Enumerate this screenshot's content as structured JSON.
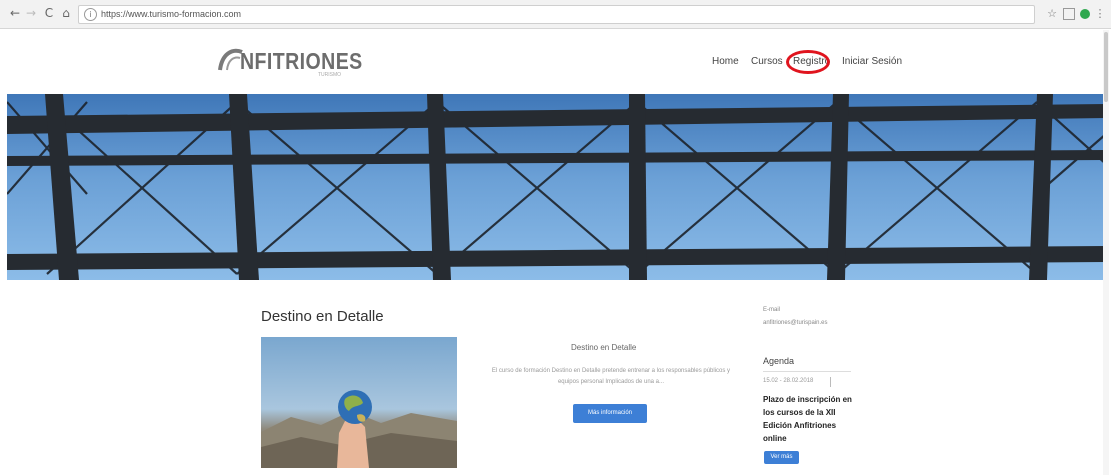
{
  "browser": {
    "url": "https://www.turismo-formacion.com",
    "back_glyph": "←",
    "forward_glyph": "→",
    "reload_glyph": "C",
    "home_glyph": "⌂",
    "info_glyph": "i",
    "star_glyph": "☆",
    "menu_glyph": "⋮"
  },
  "site": {
    "logo_text": "NFITRIONES",
    "logo_sub": "TURISMO",
    "nav": [
      {
        "label": "Home"
      },
      {
        "label": "Cursos"
      },
      {
        "label": "Registro"
      },
      {
        "label": "Iniciar Sesión"
      }
    ],
    "annotation_color": "#e0141e"
  },
  "main": {
    "page_title": "Destino en Detalle",
    "post_title": "Destino en Detalle",
    "excerpt": "El curso de formación Destino en Detalle pretende entrenar a los responsables públicos y equipos personal Implicados de una a...",
    "more_button": "Más información"
  },
  "sidebar": {
    "email_label": "E-mail",
    "email": "anfitriones@turispain.es",
    "agenda_title": "Agenda",
    "event_date": "15.02 - 28.02.2018",
    "event_title": "Plazo de inscripción en los cursos de la XII Edición Anfitriones online",
    "event_button": "Ver más"
  },
  "colors": {
    "accent": "#3d7fd6",
    "sky": "#6ba0d6"
  }
}
